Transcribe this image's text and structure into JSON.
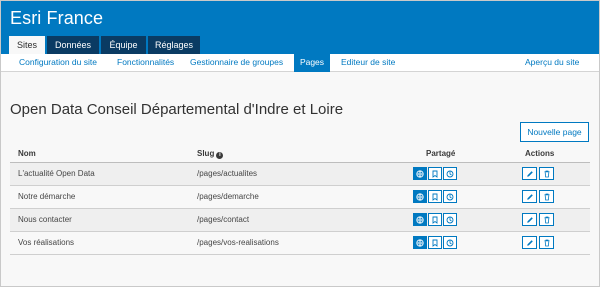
{
  "header": {
    "org_title": "Esri France",
    "tabs": [
      "Sites",
      "Données",
      "Équipe",
      "Réglages"
    ],
    "active_tab": "Sites"
  },
  "subnav": {
    "items": [
      "Configuration du site",
      "Fonctionnalités",
      "Gestionnaire de groupes",
      "Pages",
      "Editeur de site"
    ],
    "active": "Pages",
    "preview_link": "Aperçu du site"
  },
  "page": {
    "title": "Open Data Conseil Départemental d'Indre et Loire",
    "new_page_button": "Nouvelle page"
  },
  "table": {
    "headers": {
      "name": "Nom",
      "slug": "Slug",
      "sharing": "Partagé",
      "actions": "Actions"
    },
    "rows": [
      {
        "name": "L'actualité Open Data",
        "slug": "/pages/actualites",
        "sharing": [
          "everyone",
          "group",
          "org"
        ],
        "active_share": "everyone"
      },
      {
        "name": "Notre démarche",
        "slug": "/pages/demarche",
        "sharing": [
          "everyone",
          "group",
          "org"
        ],
        "active_share": "everyone"
      },
      {
        "name": "Nous contacter",
        "slug": "/pages/contact",
        "sharing": [
          "everyone",
          "group",
          "org"
        ],
        "active_share": "everyone"
      },
      {
        "name": "Vos réalisations",
        "slug": "/pages/vos-realisations",
        "sharing": [
          "everyone",
          "group",
          "org"
        ],
        "active_share": "everyone"
      }
    ],
    "action_icons": [
      "pencil-icon",
      "trash-icon"
    ]
  },
  "colors": {
    "brand": "#0079c1",
    "tab_dark": "#0a3b63"
  }
}
